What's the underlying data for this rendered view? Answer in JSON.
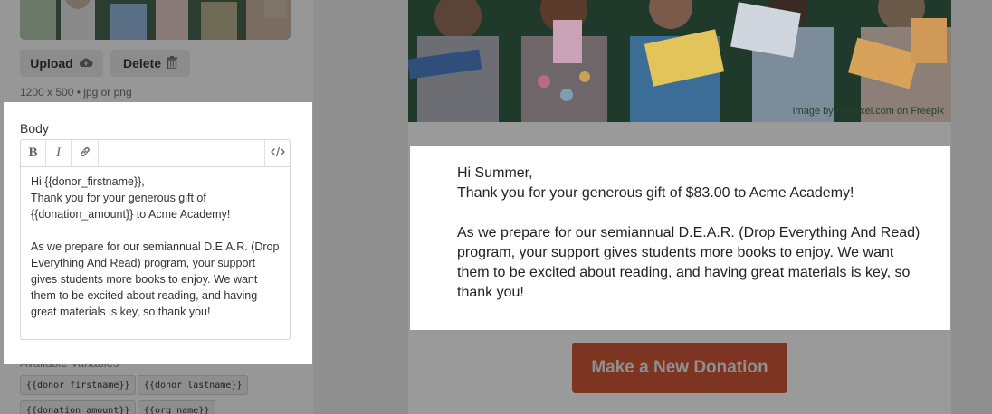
{
  "sidebar": {
    "image_actions": {
      "upload_label": "Upload",
      "delete_label": "Delete",
      "size_hint": "1200 x 500  •  jpg or png"
    },
    "body": {
      "label": "Body",
      "toolbar": {
        "bold": "B",
        "italic": "I",
        "link_icon": "link-icon",
        "code_icon": "code-icon"
      },
      "content": "Hi {{donor_firstname}},\nThank you for your generous gift of {{donation_amount}} to Acme Academy!\n\nAs we prepare for our semiannual D.E.A.R. (Drop Everything And Read) program, your support gives students more books to enjoy. We want them to be excited about reading, and having great materials is key, so thank you!"
    },
    "available_variables": {
      "label": "Available Variables",
      "items": [
        "{{donor_firstname}}",
        "{{donor_lastname}}",
        "{{donation_amount}}",
        "{{org_name}}"
      ]
    }
  },
  "preview": {
    "image_credit": "Image by rawpixel.com on Freepik",
    "greeting": "Hi Summer,\nThank you for your generous gift of $83.00 to Acme Academy!\n\nAs we prepare for our semiannual D.E.A.R. (Drop Everything And Read) program, your support gives students more books to enjoy. We want them to be excited about reading, and having great materials is key, so thank you!",
    "donate_button": "Make a New Donation"
  },
  "colors": {
    "overlay": "#979797",
    "button_brand": "#7d3522",
    "highlight": "#ffffff"
  }
}
